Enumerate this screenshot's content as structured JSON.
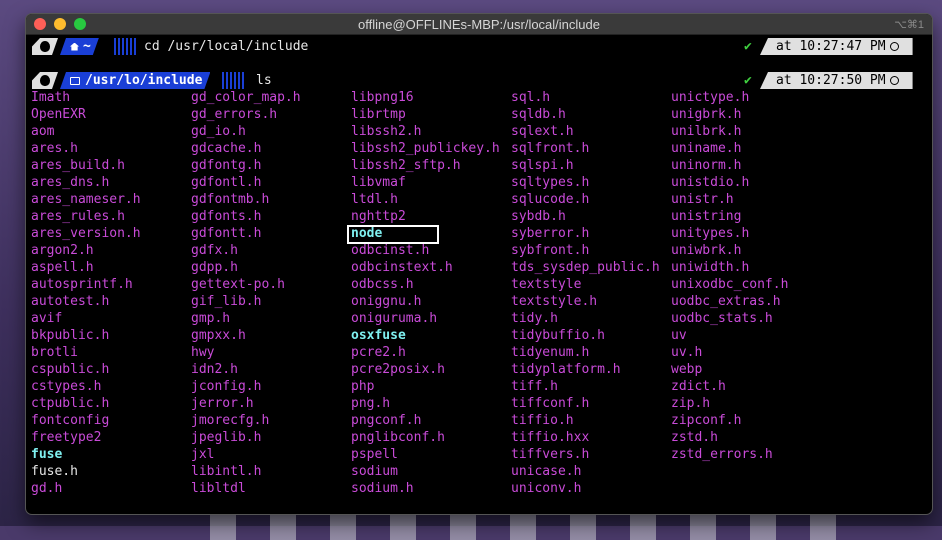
{
  "window": {
    "title": "offline@OFFLINEs-MBP:/usr/local/include",
    "shortcut": "⌥⌘1"
  },
  "prompts": [
    {
      "dir_label": "~",
      "command": "cd /usr/local/include",
      "status": "✔",
      "time": "at 10:27:47 PM"
    },
    {
      "dir_label": "/usr/lo/include",
      "command": "ls",
      "status": "✔",
      "time": "at 10:27:50 PM"
    }
  ],
  "colors": {
    "file": "#c94bd8",
    "dir": "#7ff0f0",
    "plain": "#e6e6e6",
    "prompt_dir_bg": "#1a3fd6",
    "ok": "#3fcf3f"
  },
  "listing": {
    "highlighted": "node",
    "columns": [
      [
        {
          "name": "Imath",
          "kind": "file"
        },
        {
          "name": "OpenEXR",
          "kind": "file"
        },
        {
          "name": "aom",
          "kind": "file"
        },
        {
          "name": "ares.h",
          "kind": "file"
        },
        {
          "name": "ares_build.h",
          "kind": "file"
        },
        {
          "name": "ares_dns.h",
          "kind": "file"
        },
        {
          "name": "ares_nameser.h",
          "kind": "file"
        },
        {
          "name": "ares_rules.h",
          "kind": "file"
        },
        {
          "name": "ares_version.h",
          "kind": "file"
        },
        {
          "name": "argon2.h",
          "kind": "file"
        },
        {
          "name": "aspell.h",
          "kind": "file"
        },
        {
          "name": "autosprintf.h",
          "kind": "file"
        },
        {
          "name": "autotest.h",
          "kind": "file"
        },
        {
          "name": "avif",
          "kind": "file"
        },
        {
          "name": "bkpublic.h",
          "kind": "file"
        },
        {
          "name": "brotli",
          "kind": "file"
        },
        {
          "name": "cspublic.h",
          "kind": "file"
        },
        {
          "name": "cstypes.h",
          "kind": "file"
        },
        {
          "name": "ctpublic.h",
          "kind": "file"
        },
        {
          "name": "fontconfig",
          "kind": "file"
        },
        {
          "name": "freetype2",
          "kind": "file"
        },
        {
          "name": "fuse",
          "kind": "dir"
        },
        {
          "name": "fuse.h",
          "kind": "plain"
        },
        {
          "name": "gd.h",
          "kind": "file"
        }
      ],
      [
        {
          "name": "gd_color_map.h",
          "kind": "file"
        },
        {
          "name": "gd_errors.h",
          "kind": "file"
        },
        {
          "name": "gd_io.h",
          "kind": "file"
        },
        {
          "name": "gdcache.h",
          "kind": "file"
        },
        {
          "name": "gdfontg.h",
          "kind": "file"
        },
        {
          "name": "gdfontl.h",
          "kind": "file"
        },
        {
          "name": "gdfontmb.h",
          "kind": "file"
        },
        {
          "name": "gdfonts.h",
          "kind": "file"
        },
        {
          "name": "gdfontt.h",
          "kind": "file"
        },
        {
          "name": "gdfx.h",
          "kind": "file"
        },
        {
          "name": "gdpp.h",
          "kind": "file"
        },
        {
          "name": "gettext-po.h",
          "kind": "file"
        },
        {
          "name": "gif_lib.h",
          "kind": "file"
        },
        {
          "name": "gmp.h",
          "kind": "file"
        },
        {
          "name": "gmpxx.h",
          "kind": "file"
        },
        {
          "name": "hwy",
          "kind": "file"
        },
        {
          "name": "idn2.h",
          "kind": "file"
        },
        {
          "name": "jconfig.h",
          "kind": "file"
        },
        {
          "name": "jerror.h",
          "kind": "file"
        },
        {
          "name": "jmorecfg.h",
          "kind": "file"
        },
        {
          "name": "jpeglib.h",
          "kind": "file"
        },
        {
          "name": "jxl",
          "kind": "file"
        },
        {
          "name": "libintl.h",
          "kind": "file"
        },
        {
          "name": "libltdl",
          "kind": "file"
        }
      ],
      [
        {
          "name": "libpng16",
          "kind": "file"
        },
        {
          "name": "librtmp",
          "kind": "file"
        },
        {
          "name": "libssh2.h",
          "kind": "file"
        },
        {
          "name": "libssh2_publickey.h",
          "kind": "file"
        },
        {
          "name": "libssh2_sftp.h",
          "kind": "file"
        },
        {
          "name": "libvmaf",
          "kind": "file"
        },
        {
          "name": "ltdl.h",
          "kind": "file"
        },
        {
          "name": "nghttp2",
          "kind": "file"
        },
        {
          "name": "node",
          "kind": "dir"
        },
        {
          "name": "odbcinst.h",
          "kind": "file"
        },
        {
          "name": "odbcinstext.h",
          "kind": "file"
        },
        {
          "name": "odbcss.h",
          "kind": "file"
        },
        {
          "name": "oniggnu.h",
          "kind": "file"
        },
        {
          "name": "oniguruma.h",
          "kind": "file"
        },
        {
          "name": "osxfuse",
          "kind": "dir"
        },
        {
          "name": "pcre2.h",
          "kind": "file"
        },
        {
          "name": "pcre2posix.h",
          "kind": "file"
        },
        {
          "name": "php",
          "kind": "file"
        },
        {
          "name": "png.h",
          "kind": "file"
        },
        {
          "name": "pngconf.h",
          "kind": "file"
        },
        {
          "name": "pnglibconf.h",
          "kind": "file"
        },
        {
          "name": "pspell",
          "kind": "file"
        },
        {
          "name": "sodium",
          "kind": "file"
        },
        {
          "name": "sodium.h",
          "kind": "file"
        }
      ],
      [
        {
          "name": "sql.h",
          "kind": "file"
        },
        {
          "name": "sqldb.h",
          "kind": "file"
        },
        {
          "name": "sqlext.h",
          "kind": "file"
        },
        {
          "name": "sqlfront.h",
          "kind": "file"
        },
        {
          "name": "sqlspi.h",
          "kind": "file"
        },
        {
          "name": "sqltypes.h",
          "kind": "file"
        },
        {
          "name": "sqlucode.h",
          "kind": "file"
        },
        {
          "name": "sybdb.h",
          "kind": "file"
        },
        {
          "name": "syberror.h",
          "kind": "file"
        },
        {
          "name": "sybfront.h",
          "kind": "file"
        },
        {
          "name": "tds_sysdep_public.h",
          "kind": "file"
        },
        {
          "name": "textstyle",
          "kind": "file"
        },
        {
          "name": "textstyle.h",
          "kind": "file"
        },
        {
          "name": "tidy.h",
          "kind": "file"
        },
        {
          "name": "tidybuffio.h",
          "kind": "file"
        },
        {
          "name": "tidyenum.h",
          "kind": "file"
        },
        {
          "name": "tidyplatform.h",
          "kind": "file"
        },
        {
          "name": "tiff.h",
          "kind": "file"
        },
        {
          "name": "tiffconf.h",
          "kind": "file"
        },
        {
          "name": "tiffio.h",
          "kind": "file"
        },
        {
          "name": "tiffio.hxx",
          "kind": "file"
        },
        {
          "name": "tiffvers.h",
          "kind": "file"
        },
        {
          "name": "unicase.h",
          "kind": "file"
        },
        {
          "name": "uniconv.h",
          "kind": "file"
        }
      ],
      [
        {
          "name": "unictype.h",
          "kind": "file"
        },
        {
          "name": "unigbrk.h",
          "kind": "file"
        },
        {
          "name": "unilbrk.h",
          "kind": "file"
        },
        {
          "name": "uniname.h",
          "kind": "file"
        },
        {
          "name": "uninorm.h",
          "kind": "file"
        },
        {
          "name": "unistdio.h",
          "kind": "file"
        },
        {
          "name": "unistr.h",
          "kind": "file"
        },
        {
          "name": "unistring",
          "kind": "file"
        },
        {
          "name": "unitypes.h",
          "kind": "file"
        },
        {
          "name": "uniwbrk.h",
          "kind": "file"
        },
        {
          "name": "uniwidth.h",
          "kind": "file"
        },
        {
          "name": "unixodbc_conf.h",
          "kind": "file"
        },
        {
          "name": "uodbc_extras.h",
          "kind": "file"
        },
        {
          "name": "uodbc_stats.h",
          "kind": "file"
        },
        {
          "name": "uv",
          "kind": "file"
        },
        {
          "name": "uv.h",
          "kind": "file"
        },
        {
          "name": "webp",
          "kind": "file"
        },
        {
          "name": "zdict.h",
          "kind": "file"
        },
        {
          "name": "zip.h",
          "kind": "file"
        },
        {
          "name": "zipconf.h",
          "kind": "file"
        },
        {
          "name": "zstd.h",
          "kind": "file"
        },
        {
          "name": "zstd_errors.h",
          "kind": "file"
        }
      ]
    ]
  }
}
